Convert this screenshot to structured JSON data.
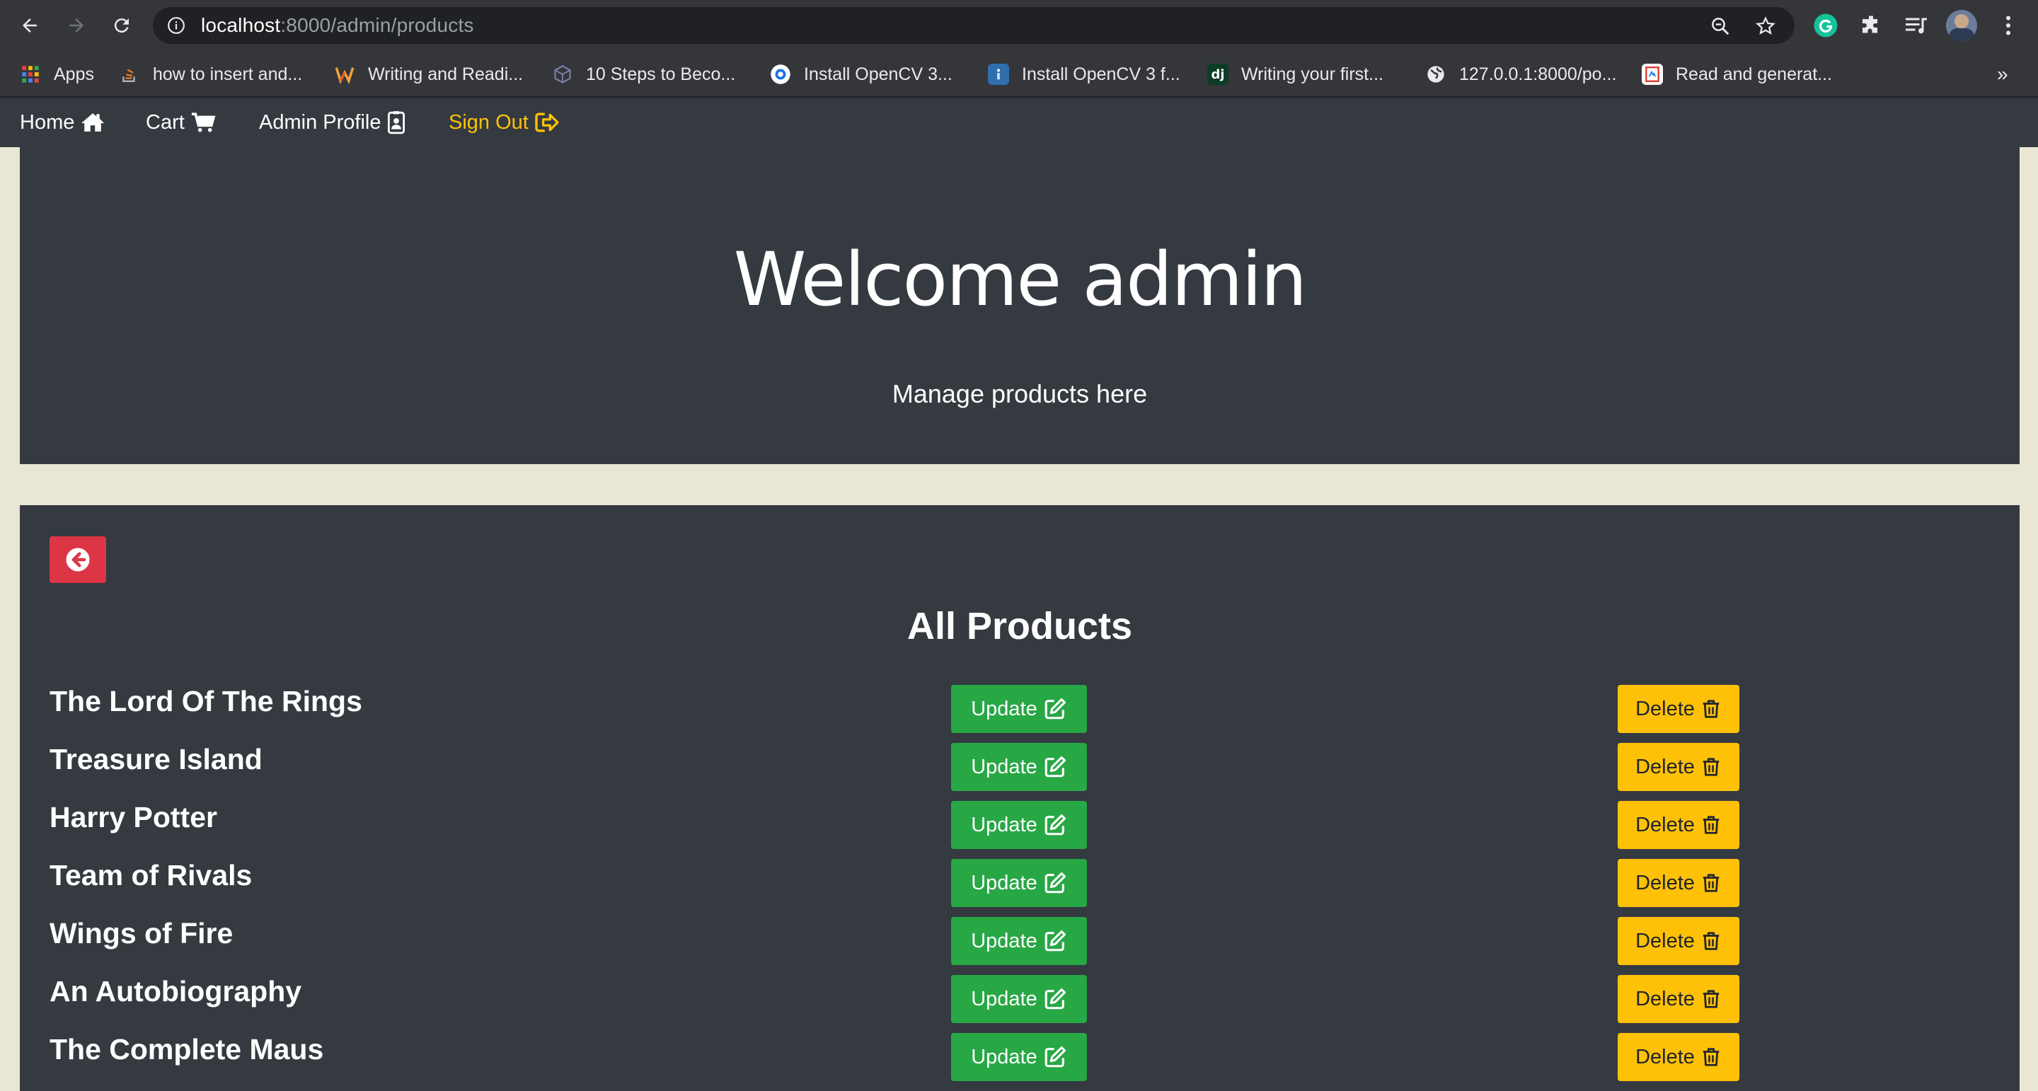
{
  "browser": {
    "url_host": "localhost",
    "url_path": ":8000/admin/products",
    "bookmarks": [
      {
        "label": "Apps",
        "icon": "apps-grid-icon"
      },
      {
        "label": "how to insert and...",
        "icon": "stackoverflow-icon"
      },
      {
        "label": "Writing and Readi...",
        "icon": "medium-m-icon"
      },
      {
        "label": "10 Steps to Beco...",
        "icon": "cube-icon"
      },
      {
        "label": "Install OpenCV 3...",
        "icon": "circle-target-icon"
      },
      {
        "label": "Install OpenCV 3 f...",
        "icon": "blue-doc-icon"
      },
      {
        "label": "Writing your first...",
        "icon": "django-dj-icon"
      },
      {
        "label": "127.0.0.1:8000/po...",
        "icon": "globe-icon"
      },
      {
        "label": "Read and generat...",
        "icon": "pdf-icon"
      }
    ],
    "overflow": "»"
  },
  "nav": {
    "home": "Home",
    "cart": "Cart",
    "profile": "Admin Profile",
    "signout": "Sign Out"
  },
  "hero": {
    "title": "Welcome admin",
    "subtitle": "Manage products here"
  },
  "products": {
    "heading": "All Products",
    "update_label": "Update",
    "delete_label": "Delete",
    "items": [
      {
        "name": "The Lord Of The Rings"
      },
      {
        "name": "Treasure Island"
      },
      {
        "name": "Harry Potter"
      },
      {
        "name": "Team of Rivals"
      },
      {
        "name": "Wings of Fire"
      },
      {
        "name": "An Autobiography"
      },
      {
        "name": "The Complete Maus"
      }
    ]
  },
  "colors": {
    "navbar": "#343a40",
    "page_bg": "#e9e6d5",
    "update": "#28a745",
    "delete": "#ffc107",
    "back": "#dc3545",
    "signout": "#ffc107"
  }
}
